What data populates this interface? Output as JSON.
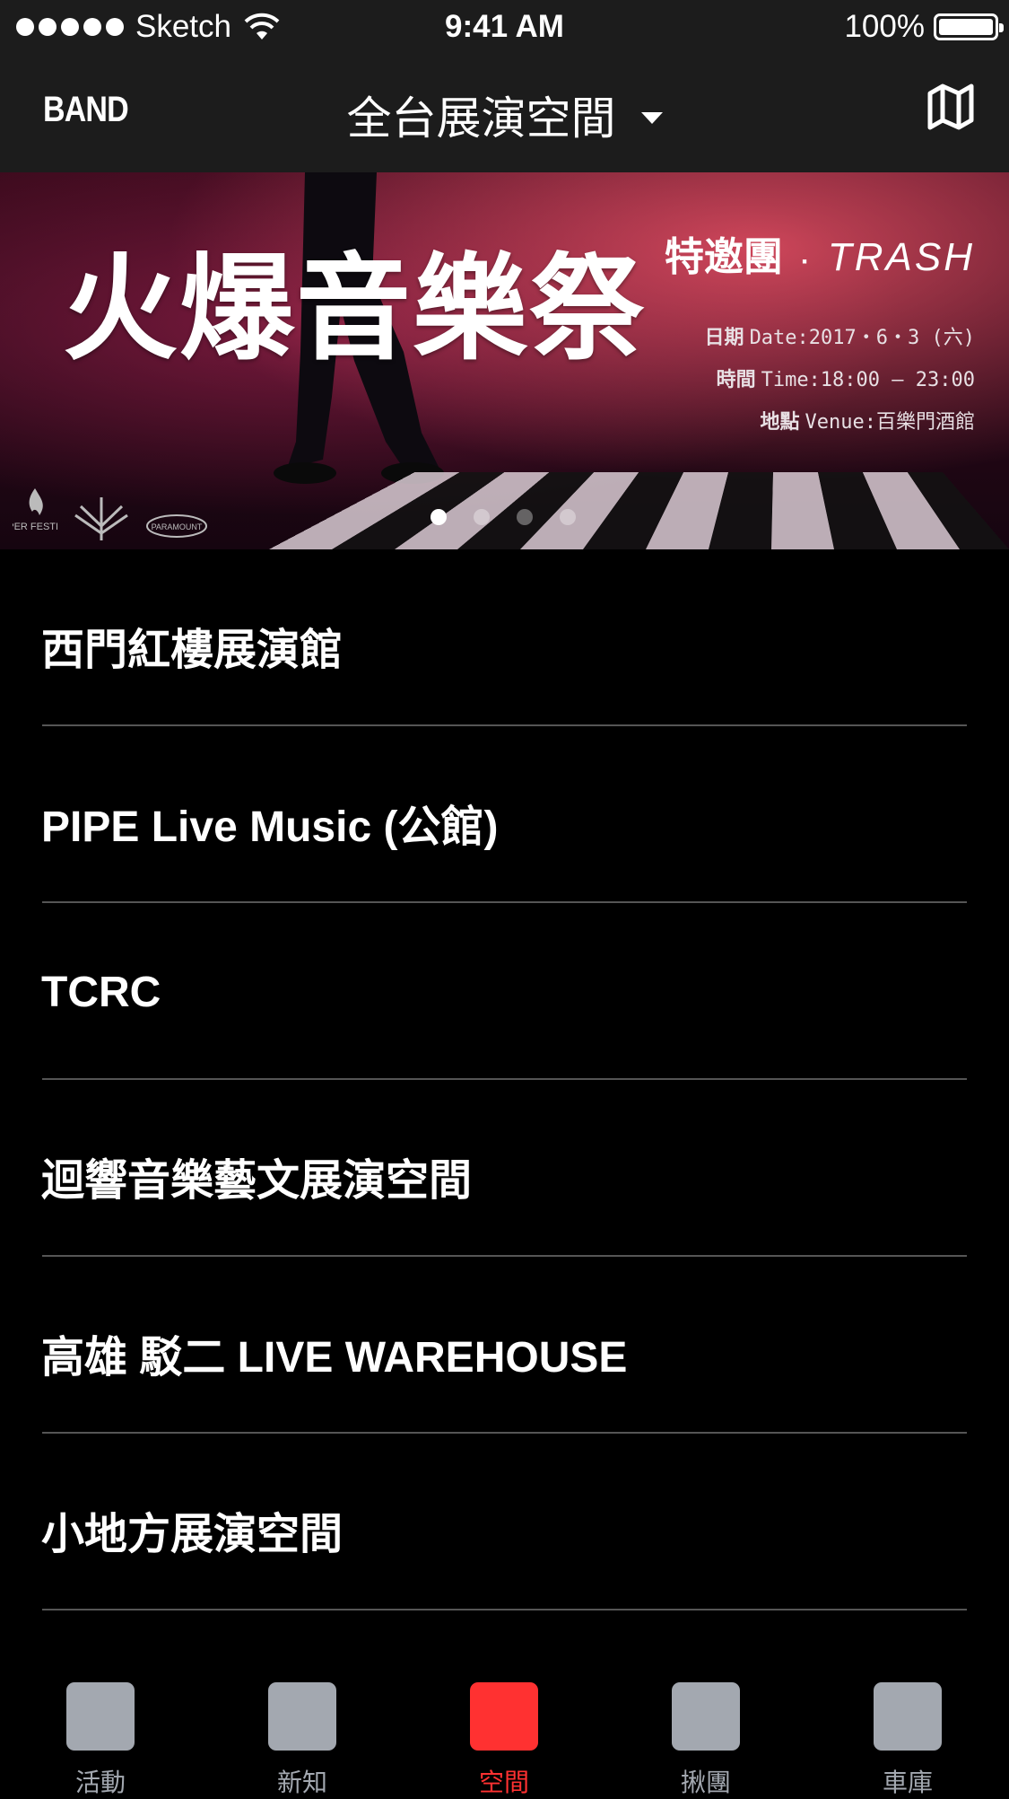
{
  "status_bar": {
    "carrier": "Sketch",
    "time": "9:41 AM",
    "battery": "100%"
  },
  "nav": {
    "brand": "BAND",
    "title": "全台展演空間",
    "map_icon": "map-icon",
    "dropdown_icon": "caret-down-icon"
  },
  "banner": {
    "title": "火爆音樂祭",
    "guest_label": "特邀團",
    "guest_sep": "·",
    "guest_band": "TRASH",
    "date_label": "日期",
    "date_value": "Date:2017・6・3 (六)",
    "time_label": "時間",
    "time_value": "Time:18:00 — 23:00",
    "venue_label": "地點",
    "venue_value": "Venue:百樂門酒館",
    "logos": [
      "HYPER FESTIVAL",
      "PARAMOUNT"
    ],
    "page_count": 4,
    "active_page": 1
  },
  "venues": [
    "西門紅樓展演館",
    "PIPE Live Music (公館)",
    "TCRC",
    "迴響音樂藝文展演空間",
    "高雄 駁二 LIVE WAREHOUSE",
    "小地方展演空間"
  ],
  "tabs": [
    {
      "label": "活動",
      "active": false
    },
    {
      "label": "新知",
      "active": false
    },
    {
      "label": "空間",
      "active": true
    },
    {
      "label": "揪團",
      "active": false
    },
    {
      "label": "車庫",
      "active": false
    }
  ],
  "colors": {
    "accent": "#ff3131",
    "tab_inactive": "#a3a8b0",
    "bar_bg": "#1c1c1c",
    "background": "#000000"
  }
}
